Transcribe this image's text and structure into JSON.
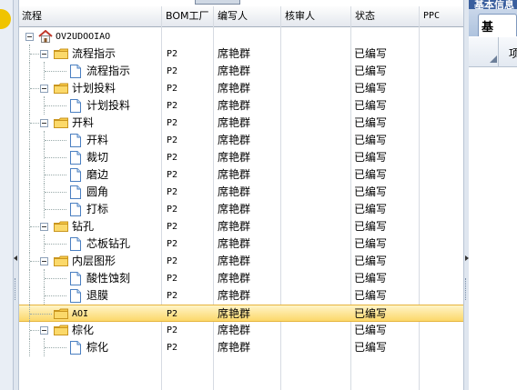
{
  "left_panel": {
    "accent_color": "#f0c400"
  },
  "grid": {
    "columns": [
      "流程",
      "BOM工厂",
      "编写人",
      "核审人",
      "状态",
      "PPC"
    ],
    "rows": [
      {
        "level": 0,
        "kind": "root",
        "name": "OV2UDOOIAO",
        "bom": "",
        "writer": "",
        "reviewer": "",
        "status": "",
        "ppc": "",
        "icon": "home-icon"
      },
      {
        "level": 1,
        "kind": "folder",
        "name": "流程指示",
        "bom": "P2",
        "writer": "席艳群",
        "reviewer": "",
        "status": "已编写",
        "ppc": "",
        "icon": "folder-icon"
      },
      {
        "level": 2,
        "kind": "doc",
        "name": "流程指示",
        "bom": "P2",
        "writer": "席艳群",
        "reviewer": "",
        "status": "已编写",
        "ppc": "",
        "icon": "document-icon"
      },
      {
        "level": 1,
        "kind": "folder",
        "name": "计划投料",
        "bom": "P2",
        "writer": "席艳群",
        "reviewer": "",
        "status": "已编写",
        "ppc": "",
        "icon": "folder-icon"
      },
      {
        "level": 2,
        "kind": "doc",
        "name": "计划投料",
        "bom": "P2",
        "writer": "席艳群",
        "reviewer": "",
        "status": "已编写",
        "ppc": "",
        "icon": "document-icon"
      },
      {
        "level": 1,
        "kind": "folder",
        "name": "开料",
        "bom": "P2",
        "writer": "席艳群",
        "reviewer": "",
        "status": "已编写",
        "ppc": "",
        "icon": "folder-icon"
      },
      {
        "level": 2,
        "kind": "doc",
        "name": "开料",
        "bom": "P2",
        "writer": "席艳群",
        "reviewer": "",
        "status": "已编写",
        "ppc": "",
        "icon": "document-icon"
      },
      {
        "level": 2,
        "kind": "doc",
        "name": "裁切",
        "bom": "P2",
        "writer": "席艳群",
        "reviewer": "",
        "status": "已编写",
        "ppc": "",
        "icon": "document-icon"
      },
      {
        "level": 2,
        "kind": "doc",
        "name": "磨边",
        "bom": "P2",
        "writer": "席艳群",
        "reviewer": "",
        "status": "已编写",
        "ppc": "",
        "icon": "document-icon"
      },
      {
        "level": 2,
        "kind": "doc",
        "name": "圆角",
        "bom": "P2",
        "writer": "席艳群",
        "reviewer": "",
        "status": "已编写",
        "ppc": "",
        "icon": "document-icon"
      },
      {
        "level": 2,
        "kind": "doc",
        "name": "打标",
        "bom": "P2",
        "writer": "席艳群",
        "reviewer": "",
        "status": "已编写",
        "ppc": "",
        "icon": "document-icon"
      },
      {
        "level": 1,
        "kind": "folder",
        "name": "钻孔",
        "bom": "P2",
        "writer": "席艳群",
        "reviewer": "",
        "status": "已编写",
        "ppc": "",
        "icon": "folder-icon"
      },
      {
        "level": 2,
        "kind": "doc",
        "name": "芯板钻孔",
        "bom": "P2",
        "writer": "席艳群",
        "reviewer": "",
        "status": "已编写",
        "ppc": "",
        "icon": "document-icon"
      },
      {
        "level": 1,
        "kind": "folder",
        "name": "内层图形",
        "bom": "P2",
        "writer": "席艳群",
        "reviewer": "",
        "status": "已编写",
        "ppc": "",
        "icon": "folder-icon"
      },
      {
        "level": 2,
        "kind": "doc",
        "name": "酸性蚀刻",
        "bom": "P2",
        "writer": "席艳群",
        "reviewer": "",
        "status": "已编写",
        "ppc": "",
        "icon": "document-icon"
      },
      {
        "level": 2,
        "kind": "doc",
        "name": "退膜",
        "bom": "P2",
        "writer": "席艳群",
        "reviewer": "",
        "status": "已编写",
        "ppc": "",
        "icon": "document-icon"
      },
      {
        "level": 1,
        "kind": "folder-leaf",
        "name": "AOI",
        "bom": "P2",
        "writer": "席艳群",
        "reviewer": "",
        "status": "已编写",
        "ppc": "",
        "icon": "folder-icon",
        "selected": true
      },
      {
        "level": 1,
        "kind": "folder",
        "name": "棕化",
        "bom": "P2",
        "writer": "席艳群",
        "reviewer": "",
        "status": "已编写",
        "ppc": "",
        "icon": "folder-icon"
      },
      {
        "level": 2,
        "kind": "doc",
        "name": "棕化",
        "bom": "P2",
        "writer": "席艳群",
        "reviewer": "",
        "status": "已编写",
        "ppc": "",
        "icon": "document-icon"
      }
    ]
  },
  "right_panel": {
    "header_label": "基本信息",
    "tab_label": "基",
    "column_label": "项",
    "header_color": "#3a5f9e"
  }
}
